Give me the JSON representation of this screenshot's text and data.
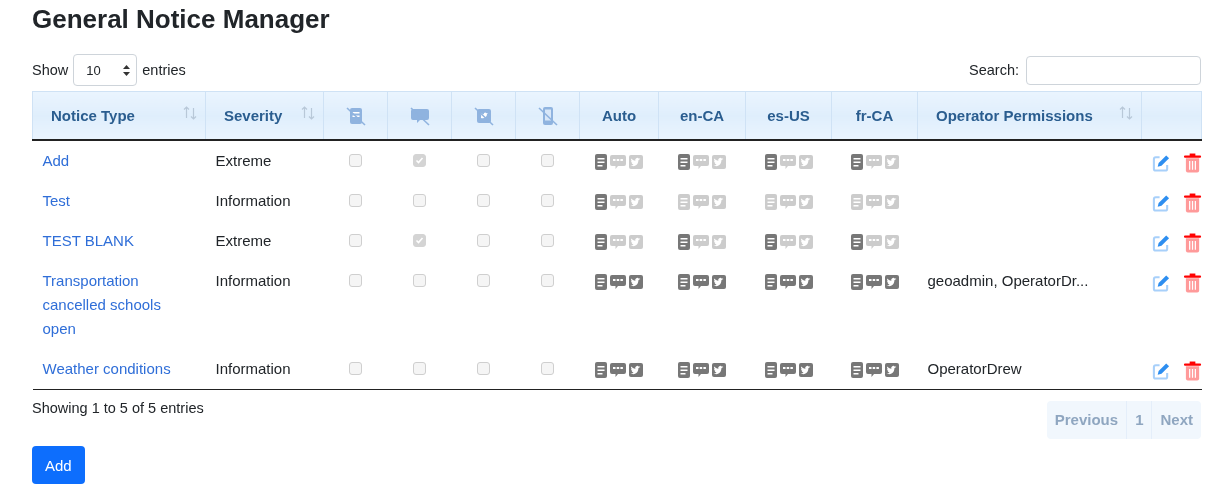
{
  "title": "General Notice Manager",
  "length_menu": {
    "label_before": "Show",
    "value": "10",
    "label_after": "entries"
  },
  "search": {
    "label": "Search:"
  },
  "columns": [
    {
      "kind": "text",
      "label": "Notice Type",
      "sortable": true
    },
    {
      "kind": "text",
      "label": "Severity",
      "sortable": true
    },
    {
      "kind": "icon"
    },
    {
      "kind": "icon"
    },
    {
      "kind": "icon"
    },
    {
      "kind": "icon"
    },
    {
      "kind": "language",
      "label": "Auto"
    },
    {
      "kind": "language",
      "label": "en-CA"
    },
    {
      "kind": "language",
      "label": "es-US"
    },
    {
      "kind": "language",
      "label": "fr-CA"
    },
    {
      "kind": "text",
      "label": "Operator Permissions",
      "sortable": true
    },
    {
      "kind": "actions"
    }
  ],
  "rows": [
    {
      "notice_type": "Add",
      "severity": "Extreme",
      "flags": [
        {
          "checked": false,
          "disabled": true
        },
        {
          "checked": true,
          "disabled": true
        },
        {
          "checked": false,
          "disabled": true
        },
        {
          "checked": false,
          "disabled": true
        }
      ],
      "languages": [
        {
          "channels": [
            {
              "on": true
            },
            {
              "on": false
            },
            {
              "on": false
            }
          ]
        },
        {
          "channels": [
            {
              "on": true
            },
            {
              "on": false
            },
            {
              "on": false
            }
          ]
        },
        {
          "channels": [
            {
              "on": true
            },
            {
              "on": false
            },
            {
              "on": false
            }
          ]
        },
        {
          "channels": [
            {
              "on": true
            },
            {
              "on": false
            },
            {
              "on": false
            }
          ]
        }
      ]
    },
    {
      "notice_type": "Test",
      "severity": "Information",
      "flags": [
        {
          "checked": false,
          "disabled": true
        },
        {
          "checked": false,
          "disabled": true
        },
        {
          "checked": false,
          "disabled": true
        },
        {
          "checked": false,
          "disabled": true
        }
      ],
      "languages": [
        {
          "channels": [
            {
              "on": true
            },
            {
              "on": false
            },
            {
              "on": false
            }
          ]
        },
        {
          "channels": [
            {
              "on": false
            },
            {
              "on": false
            },
            {
              "on": false
            }
          ]
        },
        {
          "channels": [
            {
              "on": false
            },
            {
              "on": false
            },
            {
              "on": false
            }
          ]
        },
        {
          "channels": [
            {
              "on": false
            },
            {
              "on": false
            },
            {
              "on": false
            }
          ]
        }
      ]
    },
    {
      "notice_type": "TEST BLANK",
      "severity": "Extreme",
      "flags": [
        {
          "checked": false,
          "disabled": true
        },
        {
          "checked": true,
          "disabled": true
        },
        {
          "checked": false,
          "disabled": true
        },
        {
          "checked": false,
          "disabled": true
        }
      ],
      "languages": [
        {
          "channels": [
            {
              "on": true
            },
            {
              "on": false
            },
            {
              "on": false
            }
          ]
        },
        {
          "channels": [
            {
              "on": true
            },
            {
              "on": false
            },
            {
              "on": false
            }
          ]
        },
        {
          "channels": [
            {
              "on": true
            },
            {
              "on": false
            },
            {
              "on": false
            }
          ]
        },
        {
          "channels": [
            {
              "on": true
            },
            {
              "on": false
            },
            {
              "on": false
            }
          ]
        }
      ]
    },
    {
      "notice_type": "Transportation cancelled schools open",
      "severity": "Information",
      "flags": [
        {
          "checked": false,
          "disabled": true
        },
        {
          "checked": false,
          "disabled": true
        },
        {
          "checked": false,
          "disabled": true
        },
        {
          "checked": false,
          "disabled": true
        }
      ],
      "languages": [
        {
          "channels": [
            {
              "on": true
            },
            {
              "on": true
            },
            {
              "on": true
            }
          ]
        },
        {
          "channels": [
            {
              "on": true
            },
            {
              "on": true
            },
            {
              "on": true
            }
          ]
        },
        {
          "channels": [
            {
              "on": true
            },
            {
              "on": true
            },
            {
              "on": true
            }
          ]
        },
        {
          "channels": [
            {
              "on": true
            },
            {
              "on": true
            },
            {
              "on": true
            }
          ]
        }
      ],
      "operators": "geoadmin, OperatorDr..."
    },
    {
      "notice_type": "Weather conditions",
      "severity": "Information",
      "flags": [
        {
          "checked": false,
          "disabled": true
        },
        {
          "checked": false,
          "disabled": true
        },
        {
          "checked": false,
          "disabled": true
        },
        {
          "checked": false,
          "disabled": true
        }
      ],
      "languages": [
        {
          "channels": [
            {
              "on": true
            },
            {
              "on": true
            },
            {
              "on": true
            }
          ]
        },
        {
          "channels": [
            {
              "on": true
            },
            {
              "on": true
            },
            {
              "on": true
            }
          ]
        },
        {
          "channels": [
            {
              "on": true
            },
            {
              "on": true
            },
            {
              "on": true
            }
          ]
        },
        {
          "channels": [
            {
              "on": true
            },
            {
              "on": true
            },
            {
              "on": true
            }
          ]
        }
      ],
      "operators": "OperatorDrew"
    }
  ],
  "info": "Showing 1 to 5 of 5 entries",
  "pagination": [
    {
      "label": "Previous",
      "disabled": true
    },
    {
      "label": "1",
      "disabled": true
    },
    {
      "label": "Next",
      "disabled": true
    }
  ],
  "add_button": "Add"
}
